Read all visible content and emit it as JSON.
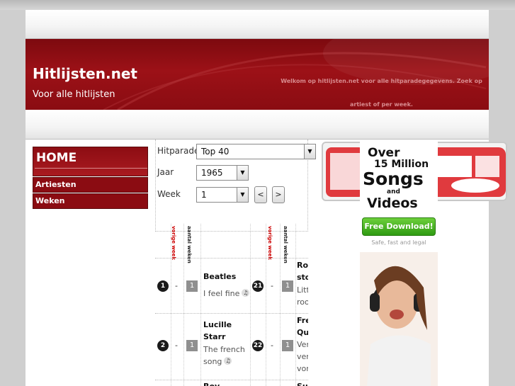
{
  "header": {
    "site_title": "Hitlijsten.net",
    "subtitle": "Voor alle hitlijsten",
    "welcome": "Welkom op hitlijsten.net voor alle hitparadegegevens. Zoek op artiest of per week."
  },
  "nav": {
    "home": "HOME",
    "items": [
      "Artiesten",
      "Weken"
    ]
  },
  "form": {
    "hitparade_label": "Hitparade",
    "hitparade_value": "Top 40",
    "jaar_label": "Jaar",
    "jaar_value": "1965",
    "week_label": "Week",
    "week_value": "1",
    "prev": "<",
    "next": ">"
  },
  "table": {
    "col_vorige": "vorige week",
    "col_aantal": "aantal weken",
    "rows": [
      {
        "pos": "1",
        "prev": "-",
        "weeks": "1",
        "artist": "Beatles",
        "song": "I feel fine"
      },
      {
        "pos": "2",
        "prev": "-",
        "weeks": "1",
        "artist": "Lucille Starr",
        "song": "The french song"
      },
      {
        "pos": "",
        "prev": "",
        "weeks": "",
        "artist": "Roy",
        "song": ""
      }
    ],
    "rows_right": [
      {
        "pos": "21",
        "prev": "-",
        "weeks": "1",
        "artist": "Rolling stones",
        "song": "Little red rooster"
      },
      {
        "pos": "22",
        "prev": "-",
        "weeks": "1",
        "artist": "Freddy Quinn",
        "song": "Vergangen vergessen vorüber"
      },
      {
        "pos": "",
        "prev": "",
        "weeks": "",
        "artist": "Supremes",
        "song": ""
      }
    ]
  },
  "ad": {
    "line1": "Over",
    "line2": "15 Million",
    "line3": "Songs",
    "line4": "and",
    "line5": "Videos",
    "button": "Free Download!",
    "small": "Safe, fast and legal"
  },
  "logo": {
    "alt": "Nederlandse Top 40 de enige echte"
  }
}
